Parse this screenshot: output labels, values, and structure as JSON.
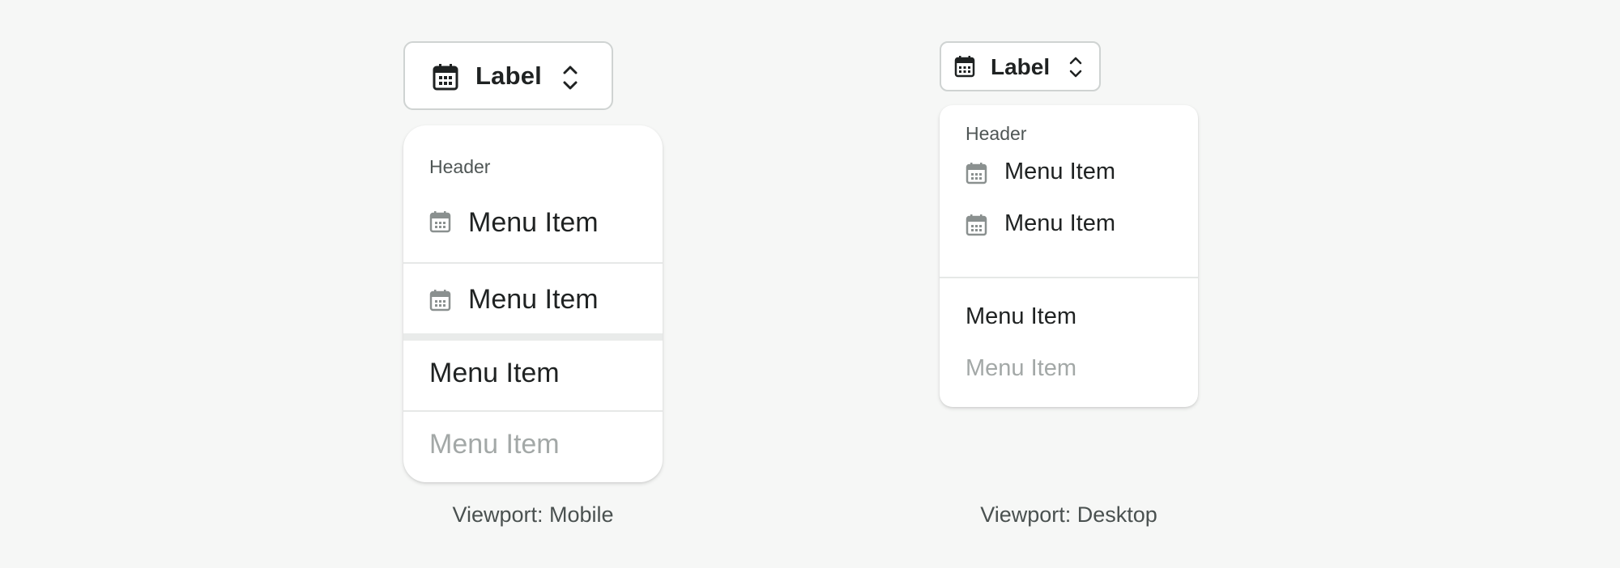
{
  "mobile": {
    "trigger": {
      "label": "Label",
      "icon": "calendar-icon",
      "indicator_icon": "chevron-up-down-icon"
    },
    "menu": {
      "header": "Header",
      "items": [
        {
          "label": "Menu Item",
          "icon": "calendar-icon",
          "state": "default"
        },
        {
          "label": "Menu Item",
          "icon": "calendar-icon",
          "state": "default"
        },
        {
          "label": "Menu Item",
          "icon": "",
          "state": "default"
        },
        {
          "label": "Menu Item",
          "icon": "",
          "state": "disabled"
        }
      ]
    },
    "caption": "Viewport: Mobile"
  },
  "desktop": {
    "trigger": {
      "label": "Label",
      "icon": "calendar-icon",
      "indicator_icon": "chevron-up-down-icon"
    },
    "menu": {
      "header": "Header",
      "items": [
        {
          "label": "Menu Item",
          "icon": "calendar-icon",
          "state": "default"
        },
        {
          "label": "Menu Item",
          "icon": "calendar-icon",
          "state": "default"
        },
        {
          "label": "Menu Item",
          "icon": "",
          "state": "default"
        },
        {
          "label": "Menu Item",
          "icon": "",
          "state": "disabled"
        }
      ]
    },
    "caption": "Viewport: Desktop"
  },
  "colors": {
    "background": "#f6f7f6",
    "text": "#1f2222",
    "header_text": "#4f5655",
    "disabled_text": "#a3a8a7",
    "icon_muted": "#8a908f",
    "border": "#cfd3d2"
  }
}
